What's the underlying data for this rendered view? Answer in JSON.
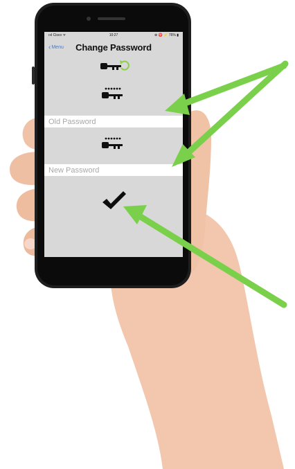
{
  "status_bar": {
    "carrier": "ıııl Cisco ᯤ",
    "time": "10:27",
    "right": "⊕ ♈ ⚡ 76% ▮"
  },
  "nav": {
    "back_label": "Menu",
    "title": "Change Password"
  },
  "fields": {
    "old_password_placeholder": "Old Password",
    "new_password_placeholder": "New Password"
  },
  "icons": {
    "key_recycle": "key-with-recycle-arrows",
    "key_dots_1": "key-with-password-dots",
    "key_dots_2": "key-with-password-dots",
    "confirm": "checkmark"
  },
  "colors": {
    "screen_bg": "#d8d8d8",
    "arrow": "#7ad04a",
    "back_link": "#3b7bd9",
    "icon_green": "#8fd14f"
  }
}
